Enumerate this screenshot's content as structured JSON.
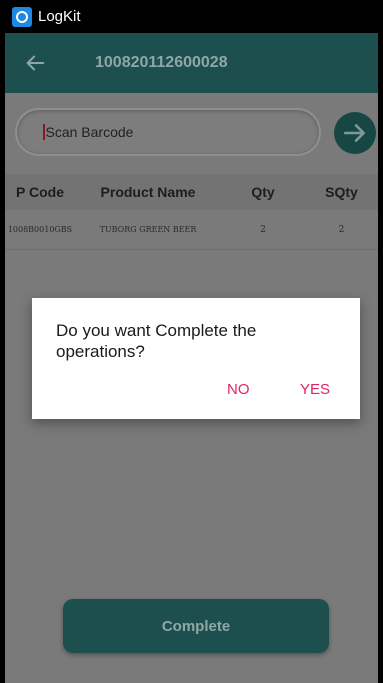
{
  "statusbar": {
    "app_name": "LogKit"
  },
  "appbar": {
    "title": "100820112600028",
    "back_icon": "arrow-left-icon"
  },
  "search": {
    "placeholder": "Scan Barcode",
    "go_icon": "arrow-right-icon"
  },
  "table": {
    "headers": {
      "code": "P Code",
      "name": "Product Name",
      "qty": "Qty",
      "sqty": "SQty"
    },
    "rows": [
      {
        "code": "1008B0010GBS",
        "name": "TUBORG GREEN BEER",
        "qty": "2",
        "sqty": "2"
      }
    ]
  },
  "footer": {
    "complete_label": "Complete"
  },
  "dialog": {
    "message": "Do you want Complete the operations?",
    "no_label": "NO",
    "yes_label": "YES"
  },
  "colors": {
    "primary_dark": "#1c4f4d",
    "accent": "#e0245e",
    "overlay": "#7a7a7a"
  }
}
